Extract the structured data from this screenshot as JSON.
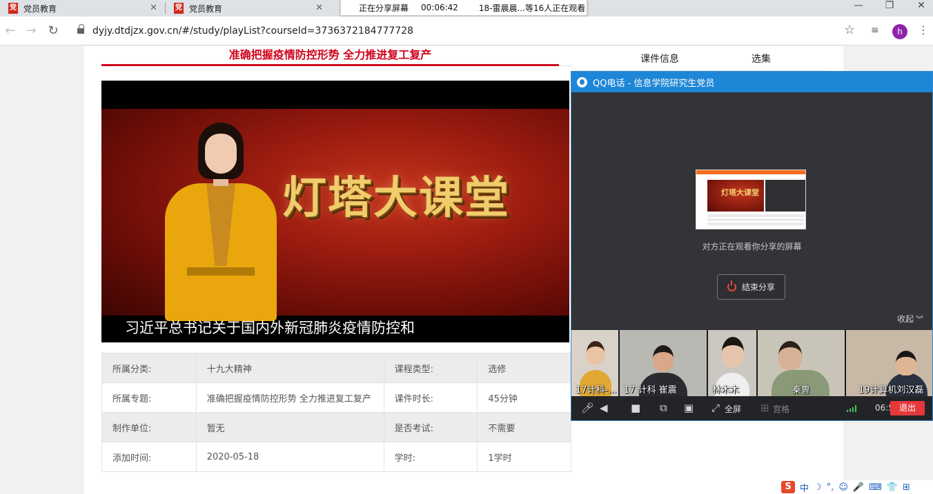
{
  "browser": {
    "tabs": [
      {
        "title": "党员教育",
        "favicon": "党"
      },
      {
        "title": "党员教育",
        "favicon": "党"
      }
    ],
    "close_glyph": "✕",
    "url": "dyjy.dtdjzx.gov.cn/#/study/playList?courseId=3736372184777728",
    "avatar_letter": "h",
    "icons": {
      "back": "←",
      "forward": "→",
      "reload": "↻",
      "star": "☆",
      "extensions": "≡",
      "menu": "⋮",
      "minimize": "—",
      "restore": "❐",
      "close": "✕"
    }
  },
  "share_bar": {
    "status": "正在分享屏幕",
    "elapsed": "00:06:42",
    "viewers": "18-雷晨晨...等16人正在观看"
  },
  "course": {
    "title": "准确把握疫情防控形势 全力推进复工复产",
    "video": {
      "brand": "灯塔大课堂",
      "subtitle": "习近平总书记关于国内外新冠肺炎疫情防控和"
    },
    "info_rows": [
      {
        "k1": "所属分类:",
        "v1": "十九大精神",
        "k2": "课程类型:",
        "v2": "选修"
      },
      {
        "k1": "所属专题:",
        "v1": "准确把握疫情防控形势 全力推进复工复产",
        "k2": "课件时长:",
        "v2": "45分钟"
      },
      {
        "k1": "制作单位:",
        "v1": "暂无",
        "k2": "是否考试:",
        "v2": "不需要"
      },
      {
        "k1": "添加时间:",
        "v1": "2020-05-18",
        "k2": "学时:",
        "v2": "1学时"
      }
    ]
  },
  "right_panel": {
    "tabs": [
      "课件信息",
      "选集"
    ]
  },
  "qq_call": {
    "window_title": "QQ电话 - 信息学院研究生党员",
    "thumbnail_brand": "灯塔大课堂",
    "watching_text": "对方正在观看你分享的屏幕",
    "end_share_label": "结束分享",
    "collapse_label": "收起",
    "participants": [
      {
        "name": "17计科-..."
      },
      {
        "name": "17 计科 崔震"
      },
      {
        "name": "林木木"
      },
      {
        "name": "秦鲁"
      },
      {
        "name": "19计算机刘汉磊"
      }
    ],
    "toolbar": {
      "fullscreen_label": "全屏",
      "grid_label": "宫格",
      "call_timer": "06:54",
      "exit_label": "退出"
    },
    "colors": {
      "title_bar": "#1e86d7",
      "exit_button": "#e5383b",
      "signal": "#46c35c"
    }
  },
  "ime_bar": {
    "logo": "S",
    "mode": "中",
    "items": [
      "☽",
      "°,",
      "☺",
      "🎤",
      "⌨",
      "👕",
      "⊞"
    ]
  }
}
